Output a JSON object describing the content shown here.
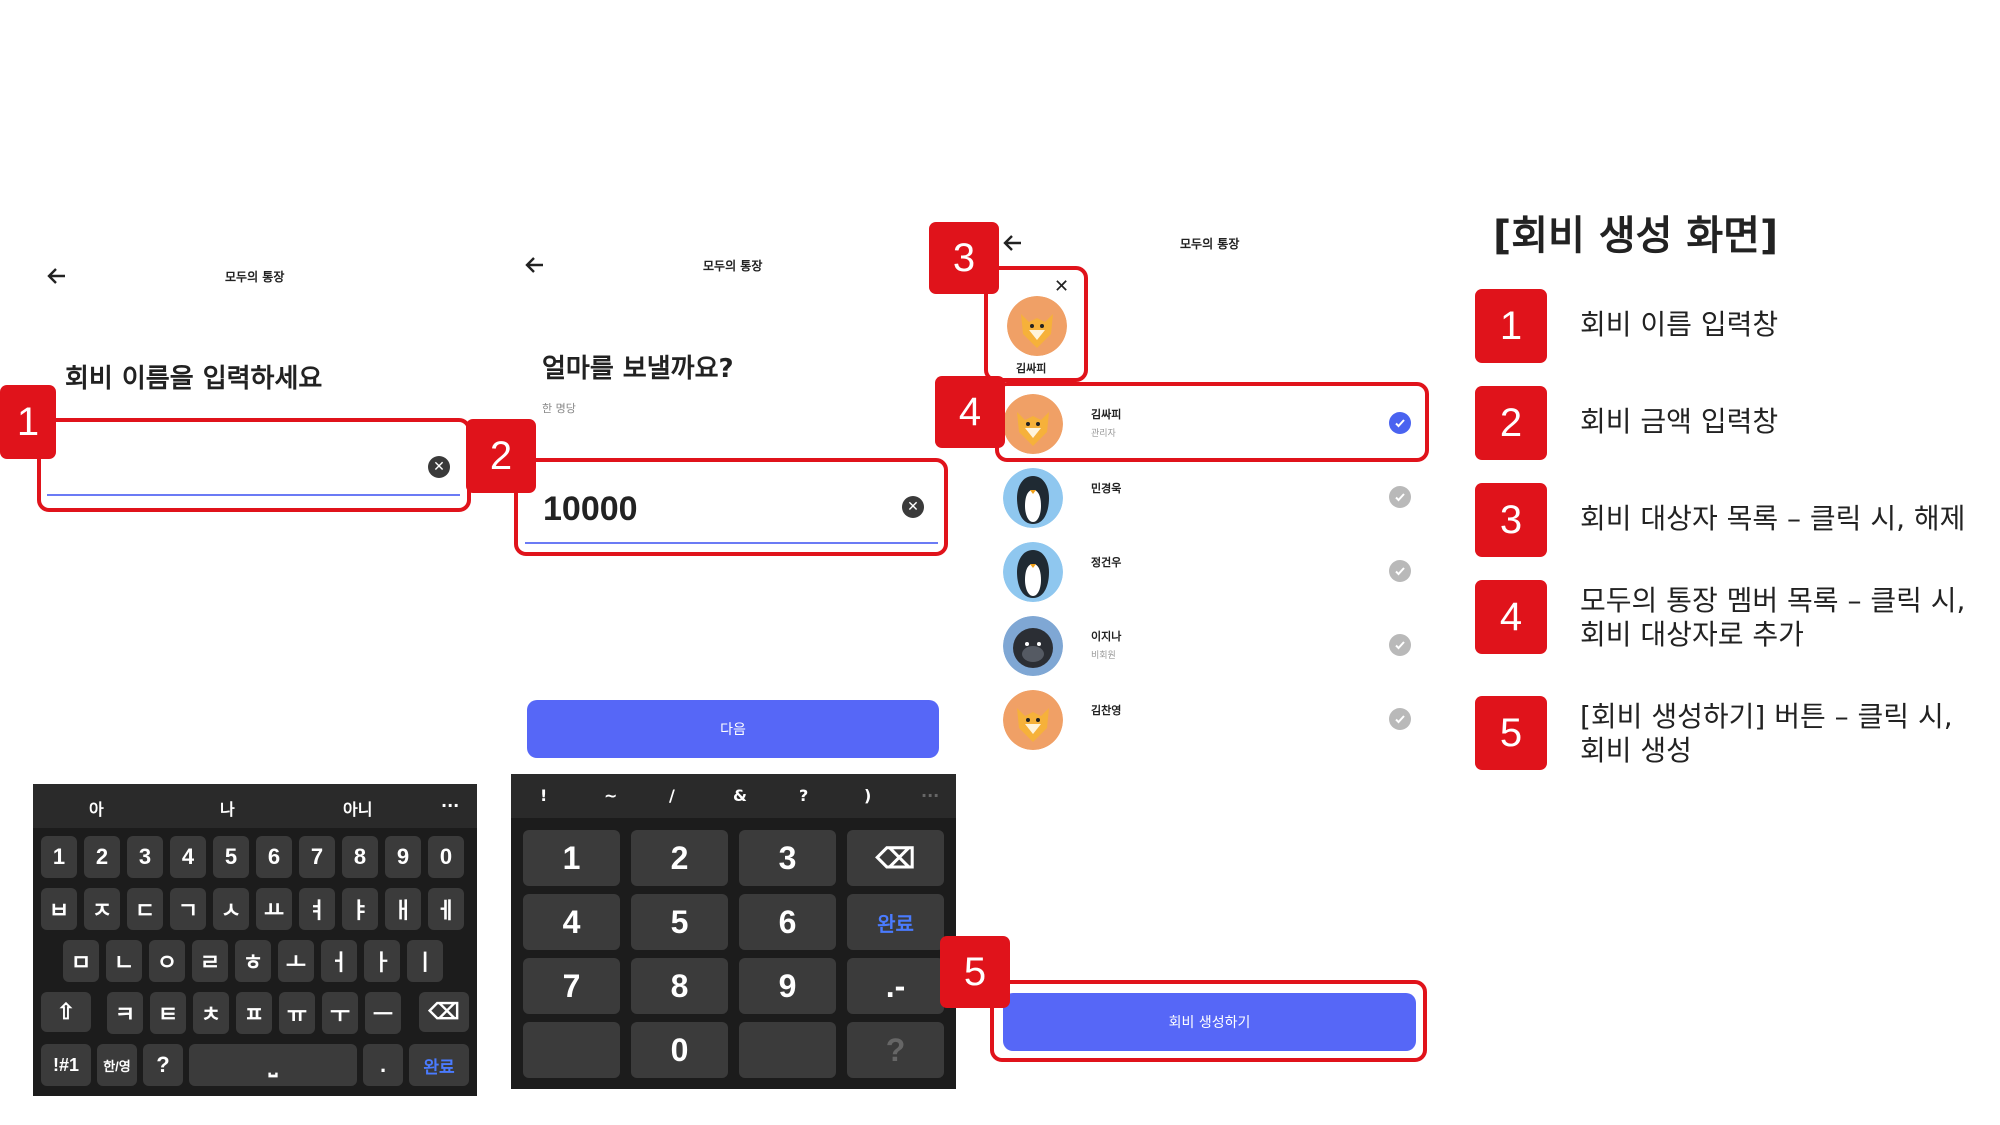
{
  "screen1": {
    "header_title": "모두의 통장",
    "prompt": "회비 이름을 입력하세요",
    "input_value": "",
    "keyboard": {
      "suggestions": [
        "아",
        "나",
        "아니",
        "···"
      ],
      "row_numbers": [
        "1",
        "2",
        "3",
        "4",
        "5",
        "6",
        "7",
        "8",
        "9",
        "0"
      ],
      "row_top": [
        "ㅂ",
        "ㅈ",
        "ㄷ",
        "ㄱ",
        "ㅅ",
        "ㅛ",
        "ㅕ",
        "ㅑ",
        "ㅐ",
        "ㅔ"
      ],
      "row_mid": [
        "ㅁ",
        "ㄴ",
        "ㅇ",
        "ㄹ",
        "ㅎ",
        "ㅗ",
        "ㅓ",
        "ㅏ",
        "ㅣ"
      ],
      "row_bot": [
        "ㅋ",
        "ㅌ",
        "ㅊ",
        "ㅍ",
        "ㅠ",
        "ㅜ",
        "ㅡ"
      ],
      "shift": "⇧",
      "backspace": "⌫",
      "symbols": "!#1",
      "lang": "한/영",
      "question": "?",
      "space": "⎵",
      "period": ".",
      "done": "완료"
    }
  },
  "screen2": {
    "header_title": "모두의 통장",
    "prompt": "얼마를 보낼까요?",
    "subtext": "한 명당",
    "input_value": "10000",
    "next_button": "다음",
    "keyboard": {
      "symbols": [
        "!",
        "~",
        "/",
        "&",
        "?",
        ")",
        "···"
      ],
      "keys": [
        "1",
        "2",
        "3",
        "4",
        "5",
        "6",
        "7",
        "8",
        "9",
        "0"
      ],
      "backspace": "⌫",
      "done": "완료",
      "dot_dash": ".-",
      "question": "?"
    }
  },
  "screen3": {
    "header_title": "모두의 통장",
    "selected": [
      {
        "name": "김싸피"
      }
    ],
    "members": [
      {
        "name": "김싸피",
        "role": "관리자",
        "checked": true,
        "avatar": "fox"
      },
      {
        "name": "민경욱",
        "role": "",
        "checked": false,
        "avatar": "penguin"
      },
      {
        "name": "정건우",
        "role": "",
        "checked": false,
        "avatar": "penguin"
      },
      {
        "name": "이지나",
        "role": "비회원",
        "checked": false,
        "avatar": "gorilla"
      },
      {
        "name": "김찬영",
        "role": "",
        "checked": false,
        "avatar": "fox"
      }
    ],
    "create_button": "회비 생성하기"
  },
  "badges": [
    "1",
    "2",
    "3",
    "4",
    "5"
  ],
  "legend": {
    "title": "[회비 생성 화면]",
    "items": [
      {
        "num": "1",
        "line1": "회비 이름 입력창",
        "line2": ""
      },
      {
        "num": "2",
        "line1": "회비 금액 입력창",
        "line2": ""
      },
      {
        "num": "3",
        "line1": "회비 대상자 목록 – 클릭 시, 해제",
        "line2": ""
      },
      {
        "num": "4",
        "line1": "모두의 통장 멤버 목록 – 클릭 시,",
        "line2": "회비 대상자로 추가"
      },
      {
        "num": "5",
        "line1": "[회비 생성하기] 버튼 – 클릭 시,",
        "line2": "회비 생성"
      }
    ]
  },
  "colors": {
    "accent_red": "#e0131b",
    "primary_blue": "#5667f7",
    "keyboard_bg": "#1c1c1c",
    "key_bg": "#3b3b3b",
    "check_blue": "#4a63f0",
    "check_gray": "#b9b9b9"
  }
}
